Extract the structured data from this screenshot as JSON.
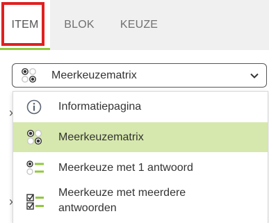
{
  "tabs": [
    {
      "label": "ITEM",
      "active": true
    },
    {
      "label": "BLOK",
      "active": false
    },
    {
      "label": "KEUZE",
      "active": false
    }
  ],
  "select": {
    "value": "Meerkeuzematrix",
    "icon": "matrix-icon"
  },
  "options": [
    {
      "label": "Informatiepagina",
      "icon": "info-icon",
      "selected": false
    },
    {
      "label": "Meerkeuzematrix",
      "icon": "matrix-icon",
      "selected": true
    },
    {
      "label": "Meerkeuze met 1 antwoord",
      "icon": "single-choice-icon",
      "selected": false
    },
    {
      "label_line1": "Meerkeuze met meerdere",
      "label_line2": "antwoorden",
      "icon": "multi-choice-icon",
      "selected": false
    }
  ],
  "colors": {
    "accent": "#92c83e",
    "highlight": "#e02020",
    "selected_bg": "#d6e8ad",
    "tab_bg": "#f0f0f0"
  }
}
